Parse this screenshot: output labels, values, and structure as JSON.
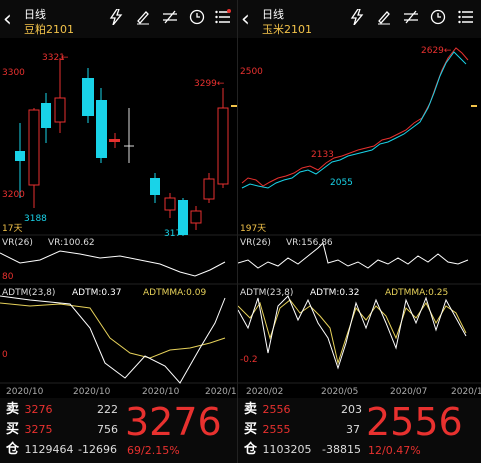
{
  "left": {
    "period": "日线",
    "symbol": "豆粕2101",
    "icons": [
      "lightning-icon",
      "draw-pen-icon",
      "indicator-icon",
      "clock-icon",
      "menu-icon"
    ],
    "y_labels": [
      "3300",
      "3200"
    ],
    "annotations": {
      "high": "3321",
      "high_arrow": "←",
      "low": "3188",
      "right": "3299←",
      "right_low": "317",
      "days": "17天"
    },
    "vr_label": "VR(26)",
    "vr_value": "VR:100.62",
    "vr_axis": "80",
    "adtm_label": "ADTM(23,8)",
    "adtm_value": "ADTM:0.37",
    "adtmma_value": "ADTMMA:0.09",
    "adtm_axis": "0",
    "dates": [
      "2020/10",
      "2020/10",
      "2020/10",
      "2020/1"
    ],
    "quote": {
      "sell_label": "卖",
      "sell_price": "3276",
      "sell_vol": "222",
      "buy_label": "买",
      "buy_price": "3275",
      "buy_vol": "756",
      "oi_label": "仓",
      "oi": "1129464",
      "oi_change": "-12696",
      "last_price": "3276",
      "change": "69/2.15%"
    }
  },
  "right": {
    "period": "日线",
    "symbol": "玉米2101",
    "icons": [
      "lightning-icon",
      "draw-pen-icon",
      "indicator-icon",
      "clock-icon",
      "menu-icon"
    ],
    "y_labels": [
      "2500"
    ],
    "annotations": {
      "high": "2629←",
      "mid": "2133",
      "low": "2055",
      "days": "197天"
    },
    "vr_label": "VR(26)",
    "vr_value": "VR:156.86",
    "adtm_label": "ADTM(23,8)",
    "adtm_value": "ADTM:0.32",
    "adtmma_value": "ADTMMA:0.25",
    "adtm_axis": "-0.2",
    "dates": [
      "2020/02",
      "2020/05",
      "2020/07",
      "2020/1"
    ],
    "quote": {
      "sell_label": "卖",
      "sell_price": "2556",
      "sell_vol": "203",
      "buy_label": "买",
      "buy_price": "2555",
      "buy_vol": "37",
      "oi_label": "仓",
      "oi": "1103205",
      "oi_change": "-38815",
      "last_price": "2556",
      "change": "12/0.47%"
    }
  },
  "colors": {
    "up": "#e8312f",
    "down": "#19d3e8",
    "accent": "#f3c34a",
    "line1": "#ffffff",
    "line2": "#e6d15a"
  }
}
